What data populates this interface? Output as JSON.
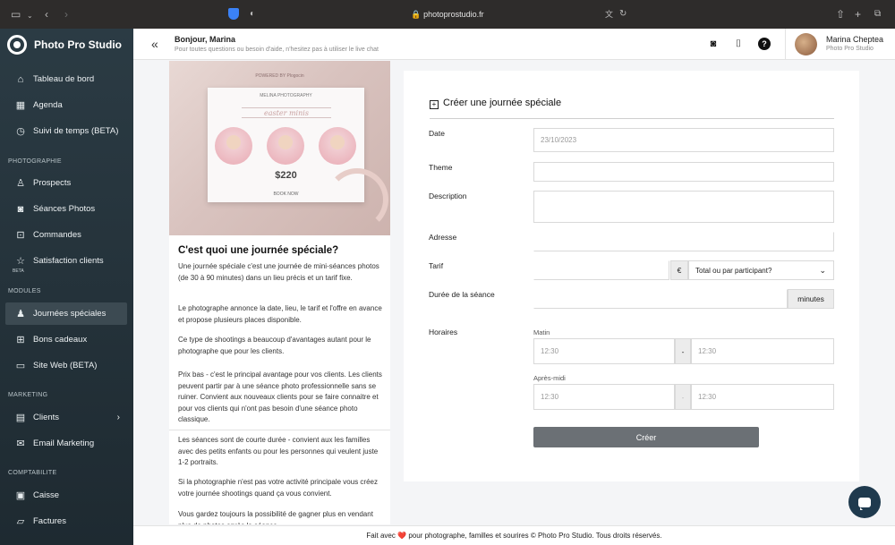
{
  "browser": {
    "url": "photoprostudio.fr",
    "icons": [
      "sidebar-toggle-icon",
      "back-icon",
      "forward-icon",
      "shield-icon",
      "reader-icon",
      "translate-icon",
      "reload-icon",
      "share-icon",
      "new-tab-icon",
      "tabs-icon"
    ]
  },
  "sidebar": {
    "brand": "Photo Pro Studio",
    "items_top": [
      {
        "label": "Tableau de bord",
        "icon": "home-icon"
      },
      {
        "label": "Agenda",
        "icon": "calendar-icon"
      },
      {
        "label": "Suivi de temps (BETA)",
        "icon": "clock-icon"
      }
    ],
    "section_photo": "PHOTOGRAPHIE",
    "items_photo": [
      {
        "label": "Prospects",
        "icon": "user-icon"
      },
      {
        "label": "Séances Photos",
        "icon": "camera-icon"
      },
      {
        "label": "Commandes",
        "icon": "chart-icon"
      },
      {
        "label": "Satisfaction clients",
        "icon": "star-icon"
      }
    ],
    "beta_badge": "BETA",
    "section_modules": "MODULES",
    "items_modules": [
      {
        "label": "Journées spéciales",
        "icon": "users-icon",
        "active": true
      },
      {
        "label": "Bons cadeaux",
        "icon": "gift-icon"
      },
      {
        "label": "Site Web (BETA)",
        "icon": "monitor-icon"
      }
    ],
    "section_marketing": "MARKETING",
    "items_marketing": [
      {
        "label": "Clients",
        "icon": "contacts-icon",
        "has_chevron": true
      },
      {
        "label": "Email Marketing",
        "icon": "mail-icon"
      }
    ],
    "section_compta": "COMPTABILITE",
    "items_compta": [
      {
        "label": "Caisse",
        "icon": "register-icon"
      },
      {
        "label": "Factures",
        "icon": "folder-icon"
      }
    ]
  },
  "header": {
    "greeting": "Bonjour, Marina",
    "subtitle": "Pour toutes questions ou besoin d'aide, n'hesitez pas à utiliser le live chat",
    "user_name": "Marina Cheptea",
    "user_company": "Photo Pro Studio"
  },
  "info": {
    "flyer": {
      "top": "POWERED BY Plogocin",
      "brand": "MELINA PHOTOGRAPHY",
      "script": "easter minis",
      "price": "$220",
      "book": "BOOK NOW"
    },
    "title": "C'est quoi une journée spéciale?",
    "paragraphs": [
      "Une journée spéciale c'est une journée de mini-séances photos (de 30 à 90 minutes) dans un lieu précis et un tarif fixe.",
      "Le photographe annonce la date, lieu, le tarif et l'offre en avance et propose plusieurs places disponible.",
      "Ce type de shootings a beaucoup d'avantages autant pour le photographe que pour les clients.",
      "Prix bas - c'est le principal avantage pour vos clients. Les clients peuvent partir par à une séance photo professionnelle sans se ruiner. Convient aux nouveaux clients pour se faire connaitre et pour vos clients qui n'ont pas besoin d'une séance photo classique.",
      "Les séances sont de courte durée - convient aux les familles avec des petits enfants ou pour les personnes qui veulent juste 1-2 portraits.",
      "Si la photographie n'est pas votre activité principale vous créez votre journée shootings quand ça vous convient.",
      "Vous gardez toujours la possibilité de gagner plus en vendant plus de photos après la séance."
    ]
  },
  "form": {
    "title": "Créer une journée spéciale",
    "date_label": "Date",
    "date_value": "23/10/2023",
    "theme_label": "Theme",
    "description_label": "Description",
    "address_label": "Adresse",
    "tarif_label": "Tarif",
    "currency": "€",
    "tarif_select": "Total ou par participant?",
    "duration_label": "Durée de la séance",
    "duration_unit": "minutes",
    "hours_label": "Horaires",
    "morning_label": "Matin",
    "afternoon_label": "Après-midi",
    "time_from": "12:30",
    "time_to": "12:30",
    "dash": "-",
    "submit": "Créer"
  },
  "footer": {
    "pre": "Fait avec",
    "heart": "❤️",
    "post": "pour  photographe, familles et sourires © Photo Pro Studio. Tous droits réservés."
  },
  "colors": {
    "sidebar_top": "#2b3b44",
    "sidebar_active": "#3c4a52",
    "button": "#6b7075",
    "chat": "#1f3a4e"
  }
}
